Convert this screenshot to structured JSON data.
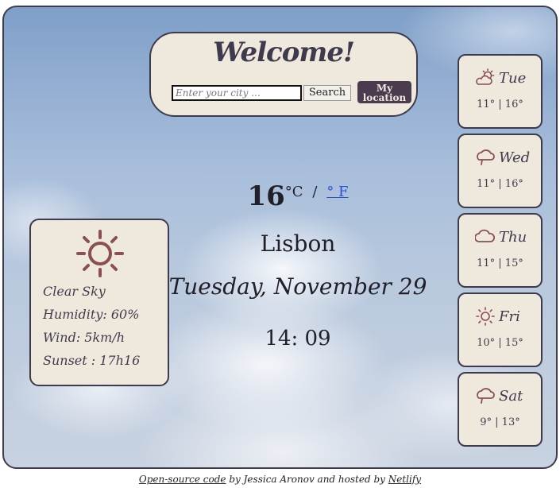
{
  "colors": {
    "accent": "#3f3b4e",
    "card_bg": "#efe8dc",
    "icon": "#8a4f4f",
    "button_bg": "#4a3b4f",
    "link": "#2a4fd8"
  },
  "header": {
    "title": "Welcome!",
    "city_placeholder": "Enter your city ...",
    "search_label": "Search",
    "location_label_1": "My",
    "location_label_2": "location"
  },
  "current": {
    "temp": "16",
    "unit_c": "°C",
    "unit_sep": "/",
    "unit_f": "° F",
    "city": "Lisbon",
    "date": "Tuesday, November 29",
    "time": "14: 09"
  },
  "today": {
    "icon": "sun-icon",
    "condition": "Clear Sky",
    "humidity": "Humidity: 60%",
    "wind": "Wind: 5km/h",
    "sunset": "Sunset : 17h16"
  },
  "forecast": [
    {
      "day": "Tue",
      "range": "11° | 16°",
      "icon": "partly-cloudy-icon"
    },
    {
      "day": "Wed",
      "range": "11° | 16°",
      "icon": "cloud-icon"
    },
    {
      "day": "Thu",
      "range": "11° | 15°",
      "icon": "cloud-icon"
    },
    {
      "day": "Fri",
      "range": "10° | 15°",
      "icon": "sun-icon"
    },
    {
      "day": "Sat",
      "range": "9° | 13°",
      "icon": "cloud-icon"
    }
  ],
  "footer": {
    "link1": "Open-source code",
    "middle": " by Jessica Aronov and hosted by ",
    "link2": "Netlify"
  }
}
